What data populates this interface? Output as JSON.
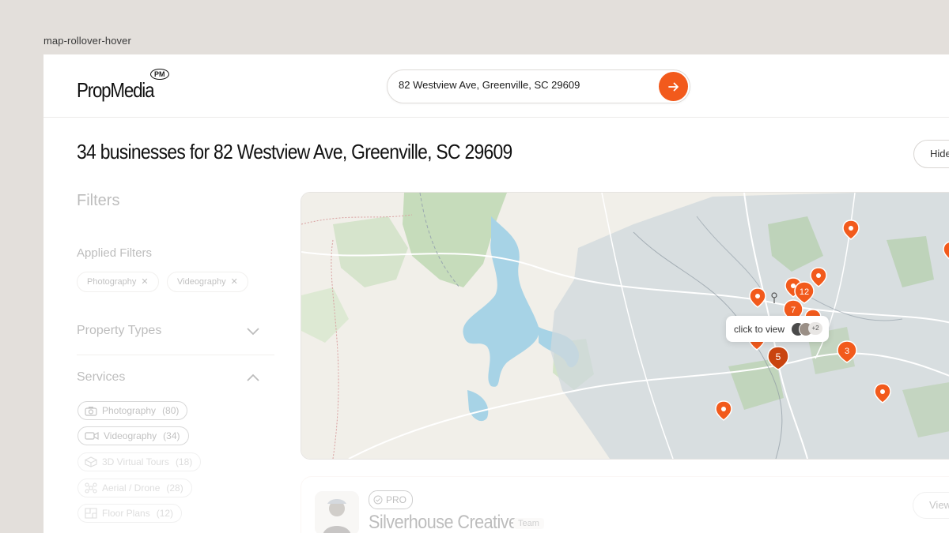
{
  "frame_label": "map-rollover-hover",
  "brand": {
    "name": "PropMedia",
    "badge": "PM",
    "accent": "#f25a1c"
  },
  "search": {
    "value": "82 Westview Ave, Greenville, SC 29609"
  },
  "results_heading": "34 businesses for 82 Westview Ave, Greenville, SC 29609",
  "hide_button_label": "Hide",
  "filters": {
    "title": "Filters",
    "applied_title": "Applied Filters",
    "applied": [
      {
        "label": "Photography",
        "remove_icon": "close-icon"
      },
      {
        "label": "Videography",
        "remove_icon": "close-icon"
      }
    ],
    "property_types_title": "Property Types",
    "services_title": "Services",
    "services": [
      {
        "label": "Photography",
        "count": "(80)",
        "icon": "camera-icon",
        "selected": true
      },
      {
        "label": "Videography",
        "count": "(34)",
        "icon": "video-icon",
        "selected": true
      },
      {
        "label": "3D Virtual Tours",
        "count": "(18)",
        "icon": "3d-tour-icon",
        "selected": false
      },
      {
        "label": "Aerial / Drone",
        "count": "(28)",
        "icon": "drone-icon",
        "selected": false
      },
      {
        "label": "Floor Plans",
        "count": "(12)",
        "icon": "floor-plan-icon",
        "selected": false
      }
    ]
  },
  "map": {
    "markers": [
      {
        "label": ""
      },
      {
        "label": "12"
      },
      {
        "label": "7"
      },
      {
        "label": "5"
      },
      {
        "label": "3"
      }
    ],
    "tooltip": {
      "text": "click to view",
      "more": "+2"
    }
  },
  "result_card": {
    "badge": "PRO",
    "name": "Silverhouse Creative",
    "tag": "Team",
    "view_label": "View"
  }
}
